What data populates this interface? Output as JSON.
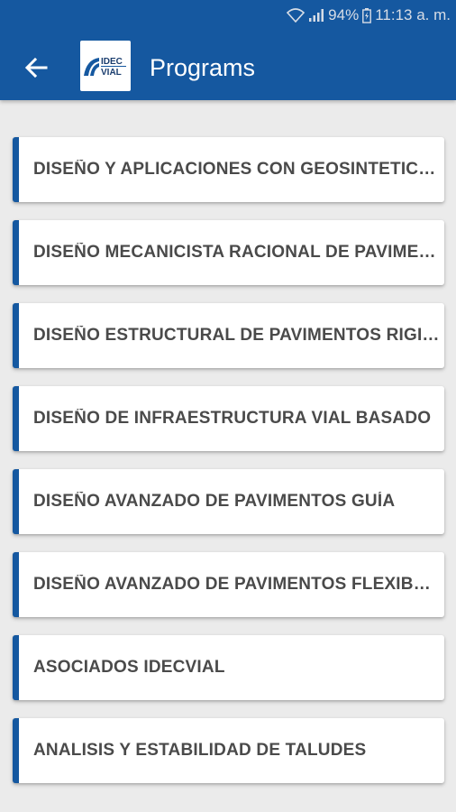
{
  "status_bar": {
    "battery": "94%",
    "time": "11:13 a. m.",
    "icons": [
      "wifi-icon",
      "signal-icon",
      "battery-icon"
    ]
  },
  "app_bar": {
    "title": "Programs",
    "back_icon": "arrow-back-icon",
    "logo_text_top": "IDEC",
    "logo_text_bottom": "VIAL",
    "color": "#1558a0"
  },
  "programs": [
    {
      "label": "DISEÑO Y APLICACIONES CON GEOSINTETICOS"
    },
    {
      "label": "DISEÑO MECANICISTA RACIONAL DE PAVIMENTOS"
    },
    {
      "label": "DISEÑO ESTRUCTURAL DE PAVIMENTOS RIGIDOS"
    },
    {
      "label": "DISEÑO DE INFRAESTRUCTURA VIAL BASADO"
    },
    {
      "label": "DISEÑO AVANZADO DE PAVIMENTOS GUÍA"
    },
    {
      "label": "DISEÑO AVANZADO DE PAVIMENTOS FLEXIBLES"
    },
    {
      "label": "ASOCIADOS IDECVIAL"
    },
    {
      "label": "ANALISIS Y ESTABILIDAD DE TALUDES"
    }
  ],
  "colors": {
    "accent": "#1558a0",
    "background": "#ebebeb",
    "card": "#ffffff",
    "text": "#4a4a4a"
  }
}
